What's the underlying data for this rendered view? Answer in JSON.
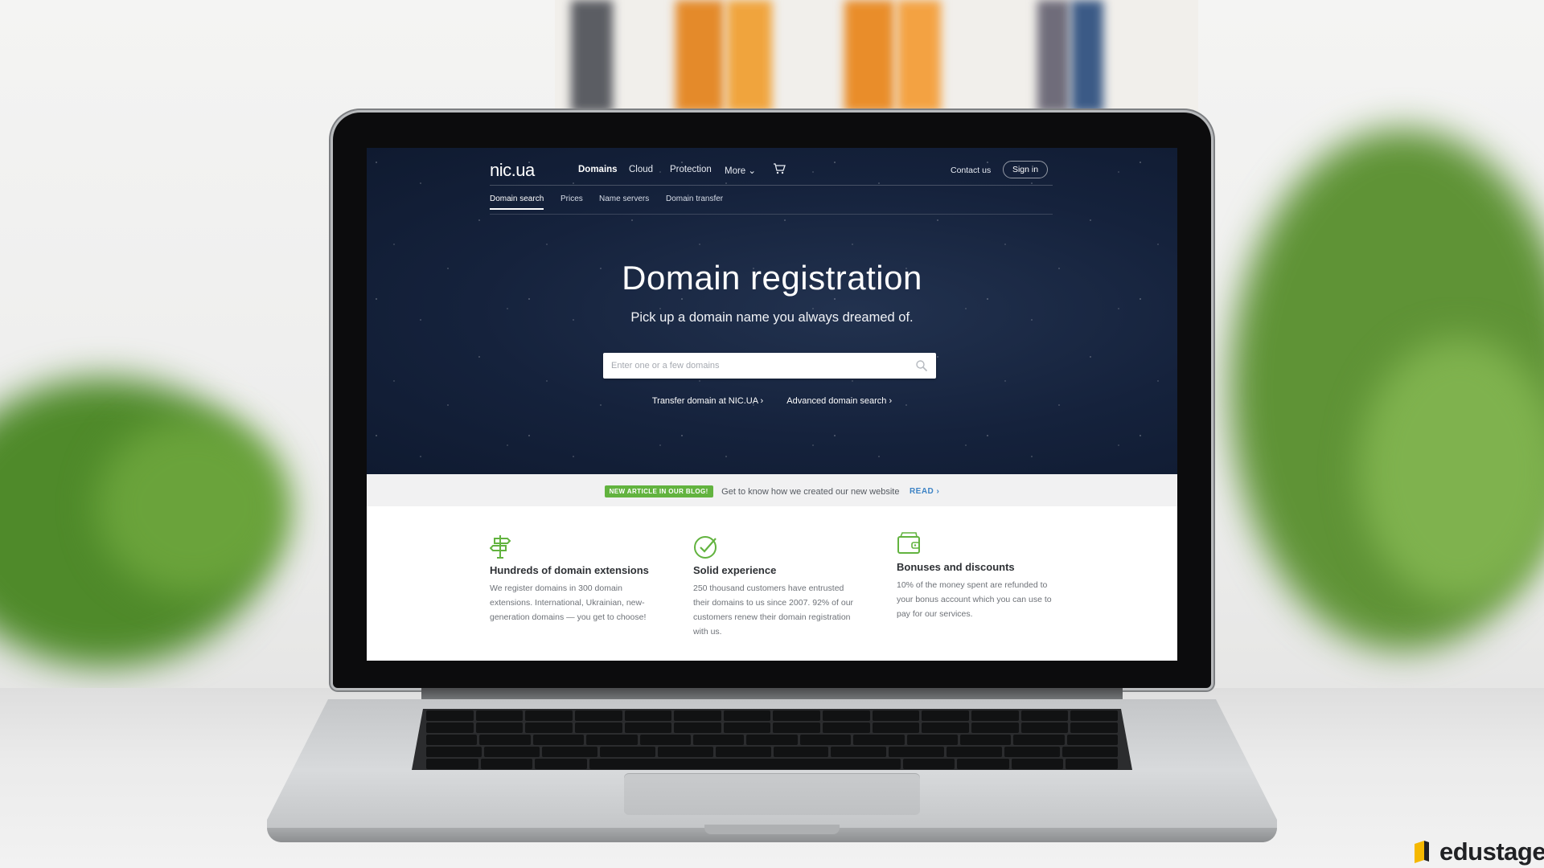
{
  "site": {
    "logo": "nic.ua",
    "nav": {
      "items": [
        "Domains",
        "Cloud",
        "Protection",
        "More ⌄"
      ],
      "contact": "Contact us",
      "sign_in": "Sign in"
    },
    "subnav": {
      "items": [
        "Domain search",
        "Prices",
        "Name servers",
        "Domain transfer"
      ]
    },
    "hero": {
      "title": "Domain registration",
      "subtitle": "Pick up a domain name you always dreamed of.",
      "search_placeholder": "Enter one or a few domains",
      "links": [
        "Transfer domain at NIC.UA ›",
        "Advanced domain search ›"
      ]
    },
    "banner": {
      "badge": "NEW ARTICLE IN OUR BLOG!",
      "text": "Get to know how we created our new website",
      "cta": "READ ›"
    },
    "features": [
      {
        "icon": "signpost-icon",
        "title": "Hundreds of domain extensions",
        "text": "We register domains in 300 domain extensions. International, Ukrainian, new-generation domains — you get to choose!"
      },
      {
        "icon": "check-circle-icon",
        "title": "Solid experience",
        "text": "250 thousand customers have entrusted their domains to us since 2007. 92% of our customers renew their domain registration with us."
      },
      {
        "icon": "wallet-icon",
        "title": "Bonuses and discounts",
        "text": "10% of the money spent are refunded to your bonus account which you can use to pay for our services."
      }
    ]
  },
  "watermark": {
    "text": "edustage"
  },
  "colors": {
    "accent_green": "#62b33f",
    "link_blue": "#3d83c5",
    "hero_bg": "#15223c"
  }
}
